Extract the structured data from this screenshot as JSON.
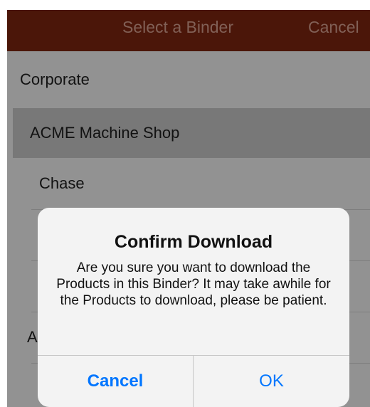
{
  "nav": {
    "title": "Select a Binder",
    "cancel_label": "Cancel",
    "bar_color": "#7d2510"
  },
  "list": {
    "items": [
      {
        "label": "Corporate",
        "selected": false
      },
      {
        "label": "ACME Machine Shop",
        "selected": true
      },
      {
        "label": "Chase",
        "selected": false
      },
      {
        "label": "A",
        "selected": false
      }
    ]
  },
  "alert": {
    "title": "Confirm Download",
    "message": "Are you sure you want to download the Products in this Binder? It may take awhile for the Products to download, please be patient.",
    "cancel_label": "Cancel",
    "ok_label": "OK",
    "button_color": "#0076ff"
  }
}
